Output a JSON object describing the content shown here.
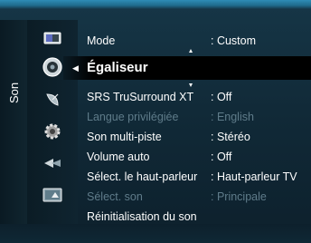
{
  "side_tab": {
    "label": "Son"
  },
  "icons": [
    {
      "name": "picture-icon"
    },
    {
      "name": "sound-icon",
      "selected": true
    },
    {
      "name": "satellite-dish-icon"
    },
    {
      "name": "settings-gear-icon"
    },
    {
      "name": "input-icon"
    },
    {
      "name": "application-icon"
    }
  ],
  "top_row": {
    "label": "Mode",
    "value": ": Custom"
  },
  "section_title": "Égaliseur",
  "items": [
    {
      "label": "SRS TruSurround XT",
      "value": ": Off",
      "enabled": true
    },
    {
      "label": "Langue privilégiée",
      "value": ": English",
      "enabled": false
    },
    {
      "label": "Son multi-piste",
      "value": ": Stéréo",
      "enabled": true
    },
    {
      "label": "Volume auto",
      "value": ": Off",
      "enabled": true
    },
    {
      "label": "Sélect. le haut-parleur",
      "value": ": Haut-parleur TV",
      "enabled": true
    },
    {
      "label": "Sélect. son",
      "value": ": Principale",
      "enabled": false
    },
    {
      "label": "Réinitialisation du son",
      "value": "",
      "enabled": true
    }
  ],
  "colors": {
    "background": "#112a38",
    "highlight": "#000000",
    "text": "#ffffff",
    "disabled_text": "#5f7c8a",
    "accent": "#2e8cb5"
  }
}
